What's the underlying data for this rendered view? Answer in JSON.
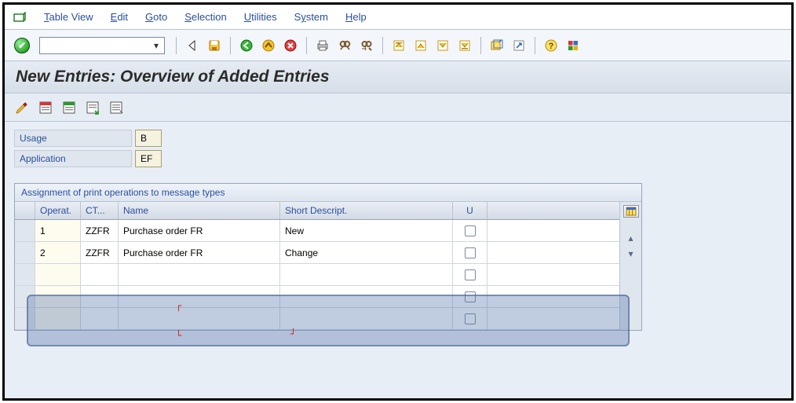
{
  "menu": {
    "table_view": "Table View",
    "edit": "Edit",
    "goto": "Goto",
    "selection": "Selection",
    "utilities": "Utilities",
    "system": "System",
    "help": "Help"
  },
  "toolbar": {
    "combo_value": ""
  },
  "screen": {
    "title": "New Entries: Overview of Added Entries"
  },
  "fields": {
    "usage_label": "Usage",
    "usage_value": "B",
    "application_label": "Application",
    "application_value": "EF"
  },
  "table": {
    "caption": "Assignment of print operations to message types",
    "headers": {
      "operat": "Operat.",
      "ctyp": "CT...",
      "name": "Name",
      "short": "Short Descript.",
      "u": "U"
    },
    "rows": [
      {
        "operat": "1",
        "ctyp": "ZZFR",
        "name": "Purchase order FR",
        "short": "New",
        "u": false
      },
      {
        "operat": "2",
        "ctyp": "ZZFR",
        "name": "Purchase order FR",
        "short": "Change",
        "u": false
      },
      {
        "operat": "",
        "ctyp": "",
        "name": "",
        "short": "",
        "u": false
      },
      {
        "operat": "",
        "ctyp": "",
        "name": "",
        "short": "",
        "u": false
      },
      {
        "operat": "",
        "ctyp": "",
        "name": "",
        "short": "",
        "u": false
      }
    ]
  },
  "icons": {
    "save": "save-icon",
    "back": "back-icon",
    "exit": "exit-icon",
    "cancel": "cancel-icon"
  }
}
